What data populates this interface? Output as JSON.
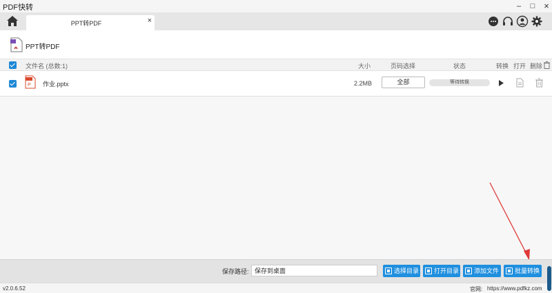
{
  "app": {
    "title": "PDF快转"
  },
  "window": {
    "minimize": "–",
    "maximize": "□",
    "close": "×"
  },
  "tab": {
    "label": "PPT转PDF",
    "close": "×"
  },
  "mode": {
    "title": "PPT转PDF"
  },
  "table": {
    "headers": {
      "name": "文件名 (总数:1)",
      "size": "大小",
      "page_select": "页码选择",
      "status": "状态",
      "convert": "转换",
      "open": "打开",
      "delete": "删除"
    },
    "rows": [
      {
        "name": "作业.pptx",
        "size": "2.2MB",
        "pages": "全部",
        "status": "等待转换"
      }
    ]
  },
  "bottom": {
    "save_path_label": "保存路径:",
    "save_path_value": "保存到桌面",
    "buttons": {
      "select_dir": "选择目录",
      "open_dir": "打开目录",
      "add_file": "添加文件",
      "batch_convert": "批量转换"
    }
  },
  "statusbar": {
    "version": "v2.0.6.52",
    "site_label": "官网:",
    "site_url": "https://www.pdfkz.com"
  },
  "colors": {
    "accent": "#1f8fdf",
    "annotation": "#e03a3a"
  }
}
